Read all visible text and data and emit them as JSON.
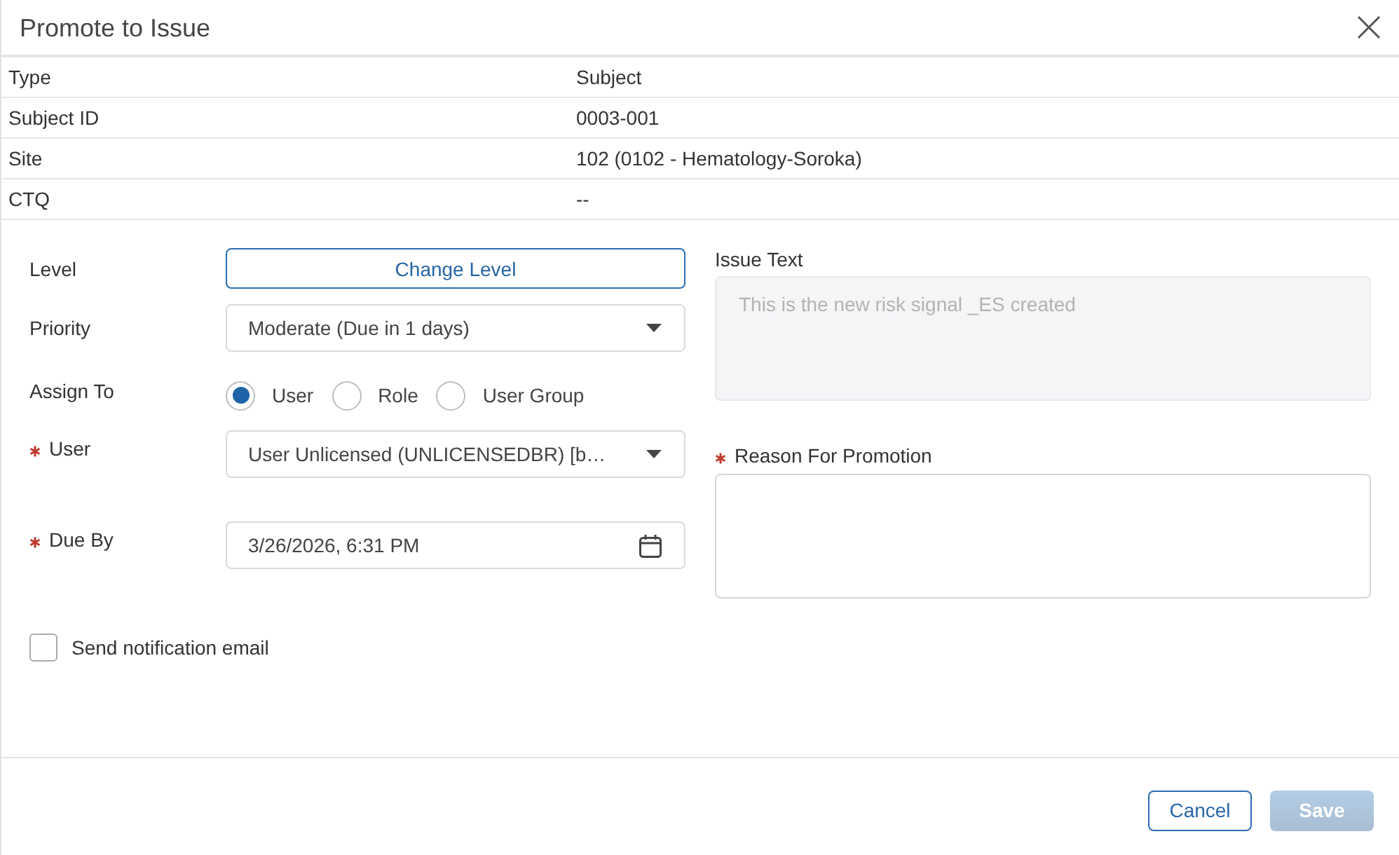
{
  "dialog": {
    "title": "Promote to Issue"
  },
  "summary": [
    {
      "label": "Type",
      "value": "Subject"
    },
    {
      "label": "Subject ID",
      "value": "0003-001"
    },
    {
      "label": "Site",
      "value": "102 (0102 - Hematology-Soroka)"
    },
    {
      "label": "CTQ",
      "value": "--"
    }
  ],
  "fields": [
    {
      "kind": "button",
      "label": "Level",
      "required": false,
      "button": "Change Level"
    },
    {
      "kind": "select",
      "label": "Priority",
      "required": false,
      "value": "Moderate (Due in 1 days)"
    },
    {
      "kind": "radio",
      "label": "Assign To",
      "required": false,
      "options": [
        {
          "label": "User",
          "selected": true
        },
        {
          "label": "Role",
          "selected": false
        },
        {
          "label": "User Group",
          "selected": false
        }
      ]
    },
    {
      "kind": "select",
      "label": "User",
      "required": true,
      "value": "User Unlicensed (UNLICENSEDBR) [b…"
    },
    {
      "kind": "date",
      "label": "Due By",
      "required": true,
      "value": "3/26/2026, 6:31 PM"
    }
  ],
  "notify": {
    "label": "Send notification email",
    "checked": false
  },
  "issue_text": {
    "label": "Issue Text",
    "value": "This is the new risk signal _ES created",
    "disabled": true
  },
  "reason": {
    "label": "Reason For Promotion",
    "required": true
  },
  "buttons": [
    {
      "label": "Cancel",
      "kind": "secondary",
      "disabled": false
    },
    {
      "label": "Save",
      "kind": "primary",
      "disabled": true
    }
  ]
}
